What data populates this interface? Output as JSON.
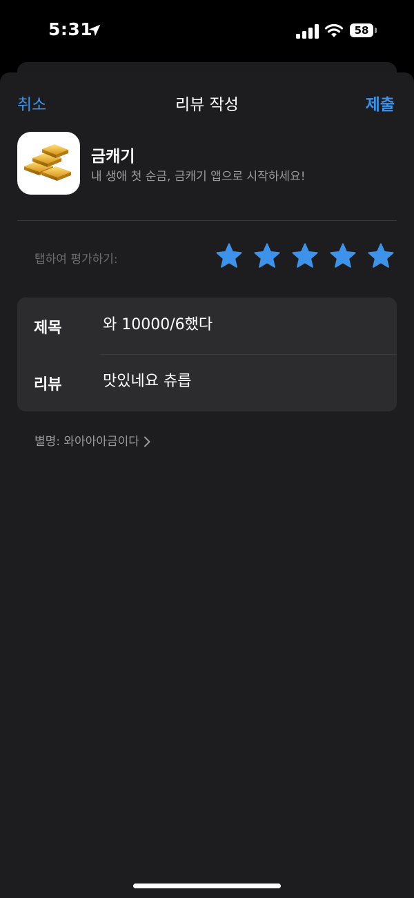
{
  "status_bar": {
    "time": "5:31",
    "battery": "58"
  },
  "nav": {
    "cancel": "취소",
    "title": "리뷰 작성",
    "submit": "제출"
  },
  "app": {
    "name": "금캐기",
    "subtitle": "내 생애 첫 순금, 금캐기 앱으로 시작하세요!",
    "icon": "gold-bars-icon"
  },
  "rating": {
    "label": "탭하여 평가하기:",
    "value": 5,
    "max": 5,
    "star_color": "#3d93ea"
  },
  "form": {
    "title_label": "제목",
    "title_value": "와 10000/6했다",
    "review_label": "리뷰",
    "review_value": "맛있네요 츄릅"
  },
  "nickname": {
    "text": "별명: 와아아아금이다"
  },
  "colors": {
    "accent": "#3d93ea",
    "sheet_bg": "#1d1d1f",
    "card_bg": "#2c2c2e"
  }
}
